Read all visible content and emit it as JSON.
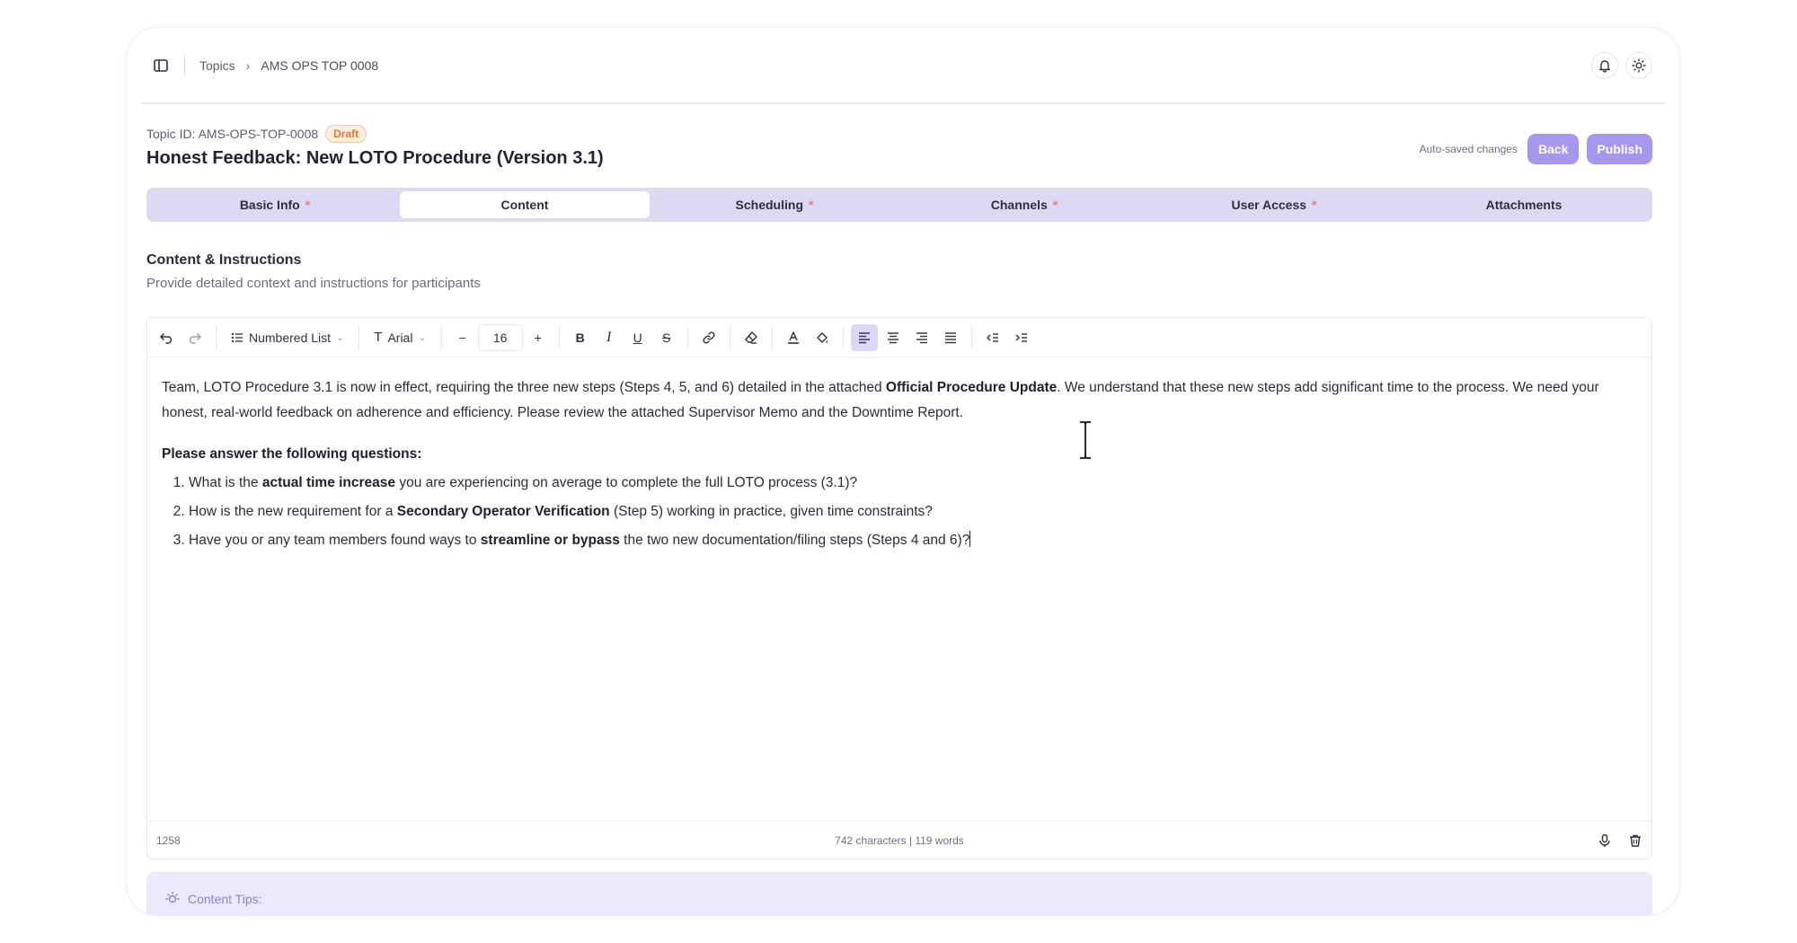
{
  "breadcrumb": {
    "parent": "Topics",
    "current": "AMS OPS TOP 0008"
  },
  "header": {
    "topic_id": "Topic ID: AMS-OPS-TOP-0008",
    "status": "Draft",
    "title": "Honest Feedback: New LOTO Procedure (Version 3.1)",
    "autosave": "Auto-saved changes",
    "back_label": "Back",
    "publish_label": "Publish"
  },
  "tabs": [
    {
      "label": "Basic Info",
      "required": "*"
    },
    {
      "label": "Content",
      "required": ""
    },
    {
      "label": "Scheduling",
      "required": "*"
    },
    {
      "label": "Channels",
      "required": "*"
    },
    {
      "label": "User Access",
      "required": "*"
    },
    {
      "label": "Attachments",
      "required": ""
    }
  ],
  "section": {
    "title": "Content & Instructions",
    "subtitle": "Provide detailed context and instructions for participants"
  },
  "toolbar": {
    "list_style": "Numbered List",
    "font": "Arial",
    "font_size": "16"
  },
  "content": {
    "p1_a": "Team, LOTO Procedure 3.1 is now in effect, requiring the three new steps (Steps 4, 5, and 6) detailed in the attached ",
    "p1_b": "Official Procedure Update",
    "p1_c": ". We understand that these new steps add significant time to the process. We need your honest, real-world feedback on adherence and efficiency. Please review the attached Supervisor Memo and the Downtime Report.",
    "questions_heading": "Please answer the following questions:",
    "q1_a": "What is the ",
    "q1_b": "actual time increase",
    "q1_c": " you are experiencing on average to complete the full LOTO process (3.1)?",
    "q2_a": "How is the new requirement for a ",
    "q2_b": "Secondary Operator Verification",
    "q2_c": " (Step 5) working in practice, given time constraints?",
    "q3_a": "Have you or any team members found ways to ",
    "q3_b": "streamline or bypass",
    "q3_c": " the two new documentation/filing steps (Steps 4 and 6)?"
  },
  "footer": {
    "remaining": "1258",
    "stats": "742 characters  |  119 words"
  },
  "tips": {
    "label": "Content Tips:"
  },
  "colors": {
    "accent": "#a796ee",
    "tab_bg": "#dcd9f2",
    "draft": "#e07a3a"
  }
}
